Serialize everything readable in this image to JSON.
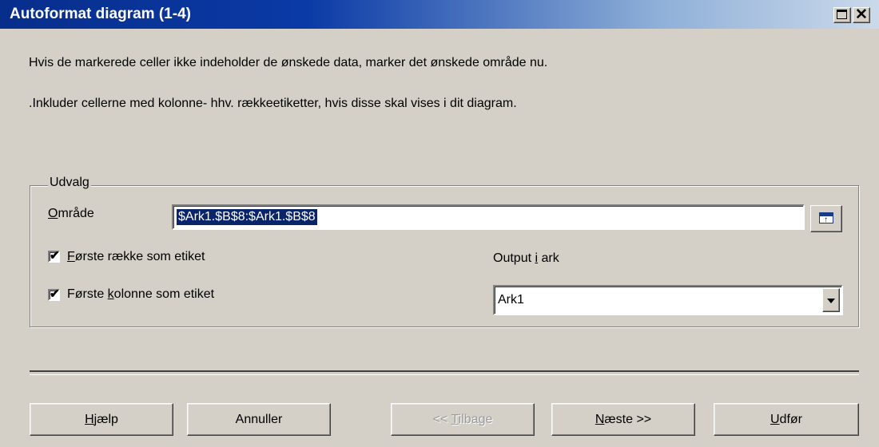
{
  "window": {
    "title": "Autoformat diagram (1-4)",
    "close_glyph": "✕"
  },
  "instructions": {
    "line1": "Hvis de markerede celler ikke indeholder de ønskede data, marker det ønskede område nu.",
    "line2": ".Inkluder cellerne med kolonne- hhv. rækkeetiketter, hvis disse skal vises i dit diagram."
  },
  "selection_group": {
    "label": "Udvalg",
    "range_label_first": "O",
    "range_label_rest": "mråde",
    "range_value": "$Ark1.$B$8:$Ark1.$B$8",
    "first_row_checked": true,
    "first_row_label_first": "F",
    "first_row_label_rest": "ørste række som etiket",
    "first_col_checked": true,
    "first_col_label_before": "Første ",
    "first_col_label_u": "k",
    "first_col_label_after": "olonne som etiket",
    "output_label_before": "Output ",
    "output_label_u": "i",
    "output_label_after": " ark",
    "output_value": "Ark1",
    "check_glyph": "✔"
  },
  "buttons": {
    "help_u": "H",
    "help_rest": "jælp",
    "cancel": "Annuller",
    "back_before": "<< ",
    "back_u": "T",
    "back_rest": "ilbage",
    "next_u": "N",
    "next_rest": "æste >>",
    "finish_u": "U",
    "finish_rest": "dfør"
  }
}
